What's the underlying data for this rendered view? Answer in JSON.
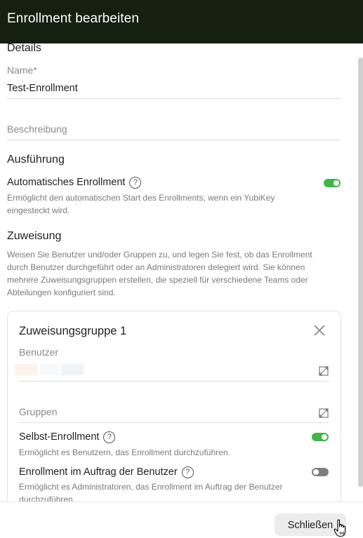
{
  "dialog": {
    "title": "Enrollment bearbeiten"
  },
  "details": {
    "section_title": "Details",
    "name_label": "Name*",
    "name_value": "Test-Enrollment",
    "description_placeholder": "Beschreibung"
  },
  "execution": {
    "section_title": "Ausführung",
    "auto_label": "Automatisches Enrollment",
    "auto_description": "Ermöglicht den automatischen Start des Enrollments, wenn ein YubiKey eingesteckt wird.",
    "auto_enabled": true
  },
  "assignment": {
    "section_title": "Zuweisung",
    "description": "Weisen Sie Benutzer und/oder Gruppen zu, und legen Sie fest, ob das Enrollment durch Benutzer durchgeführt oder an Administratoren delegiert wird. Sie können mehrere Zuweisungsgruppen erstellen, die speziell für verschiedene Teams oder Abteilungen konfiguriert sind.",
    "group": {
      "title": "Zuweisungsgruppe 1",
      "users_label": "Benutzer",
      "groups_label": "Gruppen",
      "self_enrollment_label": "Selbst-Enrollment",
      "self_enrollment_description": "Ermöglicht es Benutzern, das Enrollment durchzuführen.",
      "self_enrollment_enabled": true,
      "on_behalf_label": "Enrollment im Auftrag der Benutzer",
      "on_behalf_description": "Ermöglicht es Administratoren, das Enrollment im Auftrag der Benutzer durchzuführen.",
      "on_behalf_enabled": false
    }
  },
  "footer": {
    "close_label": "Schließen"
  },
  "colors": {
    "header_bg": "#142010",
    "toggle_on": "#3fb546",
    "toggle_off": "#7d7d7d"
  },
  "icons": {
    "help": "help-circle-icon",
    "close": "close-icon",
    "expand": "expand-icon",
    "cursor": "hand-pointer-icon"
  }
}
